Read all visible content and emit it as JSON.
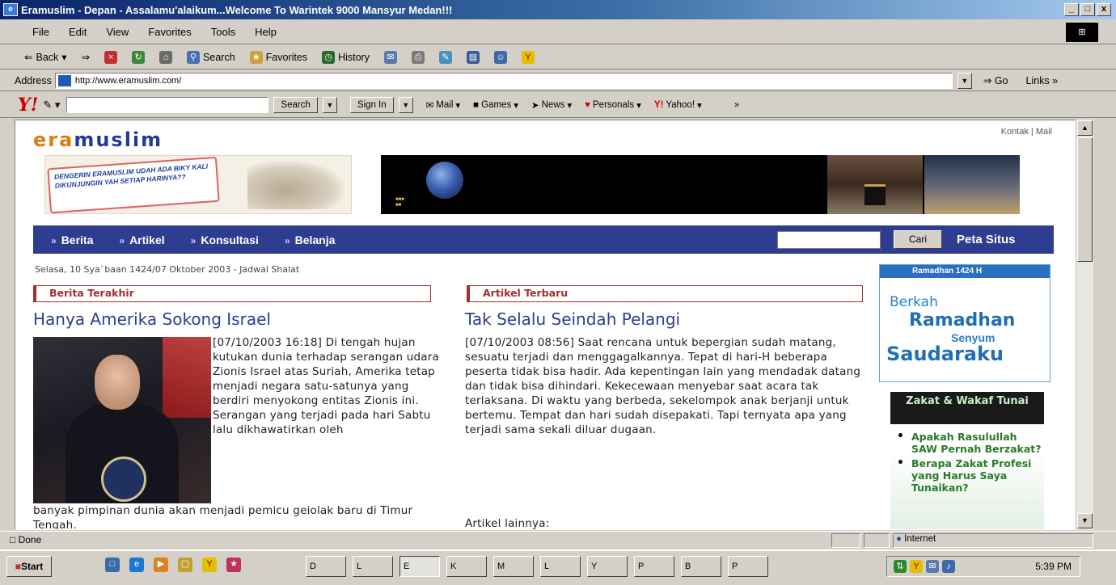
{
  "window": {
    "title": "Eramuslim - Depan - Assalamu'alaikum...Welcome To Warintek 9000 Mansyur Medan!!!",
    "controls": [
      "_",
      "□",
      "x"
    ]
  },
  "menu": [
    "File",
    "Edit",
    "View",
    "Favorites",
    "Tools",
    "Help"
  ],
  "toolbar": {
    "back": "Back",
    "search": "Search",
    "favorites": "Favorites",
    "history": "History"
  },
  "address": {
    "label": "Address",
    "url": "http://www.eramuslim.com/",
    "go": "Go",
    "links": "Links"
  },
  "yahoo_bar": {
    "logo": "Y!",
    "search_btn": "Search",
    "signin": "Sign In",
    "mail": "Mail",
    "games": "Games",
    "news": "News",
    "personals": "Personals",
    "yahoo": "Yahoo!"
  },
  "page": {
    "logo_era": "era",
    "logo_muslim": "muslim",
    "toplinks": "Kontak | Mail",
    "banner1_text": "DENGERIN ERAMUSLIM UDAH ADA BIKY KALI DIKUNJUNGIN YAH SETIAP HARINYA??",
    "nav": {
      "items": [
        "Berita",
        "Artikel",
        "Konsultasi",
        "Belanja"
      ],
      "cari": "Cari",
      "peta": "Peta Situs"
    },
    "dateline": "Selasa, 10 Sya`baan 1424/07 Oktober 2003 - Jadwal Shalat",
    "berita": {
      "header": "Berita Terakhir",
      "headline": "Hanya Amerika Sokong Israel",
      "text": "[07/10/2003 16:18] Di tengah hujan kutukan dunia terhadap serangan udara Zionis Israel atas Suriah, Amerika tetap menjadi negara satu-satunya yang berdiri menyokong entitas Zionis ini. Serangan yang terjadi pada hari Sabtu lalu dikhawatirkan oleh",
      "text_cont": "banyak pimpinan dunia akan menjadi pemicu geiolak baru di Timur Tengah."
    },
    "artikel": {
      "header": "Artikel Terbaru",
      "headline": "Tak Selalu Seindah Pelangi",
      "text": "[07/10/2003 08:56] Saat rencana untuk bepergian sudah matang, sesuatu terjadi dan menggagalkannya. Tepat di hari-H beberapa peserta tidak bisa hadir. Ada kepentingan lain yang mendadak datang dan tidak bisa dihindari. Kekecewaan menyebar saat acara tak terlaksana. Di waktu yang berbeda, sekelompok anak berjanji untuk bertemu. Tempat dan hari sudah disepakati. Tapi ternyata apa yang terjadi sama sekali diluar dugaan.",
      "lainnya": "Artikel lainnya:"
    },
    "ramadhan": {
      "bar": "Ramadhan 1424 H",
      "l1": "Berkah",
      "l2": "Ramadhan",
      "l3": "Senyum",
      "l4": "Saudaraku"
    },
    "zakat": {
      "header": "Zakat & Wakaf Tunai",
      "items": [
        "Apakah Rasulullah SAW Pernah Berzakat?",
        "Berapa Zakat Profesi yang Harus Saya Tunaikan?"
      ]
    }
  },
  "status": {
    "text": "Done",
    "zone": "Internet"
  },
  "taskbar": {
    "start": "Start",
    "tasks": [
      "D",
      "L",
      "E",
      "K",
      "M",
      "L",
      "Y",
      "P",
      "B",
      "P"
    ],
    "clock": "5:39 PM"
  }
}
